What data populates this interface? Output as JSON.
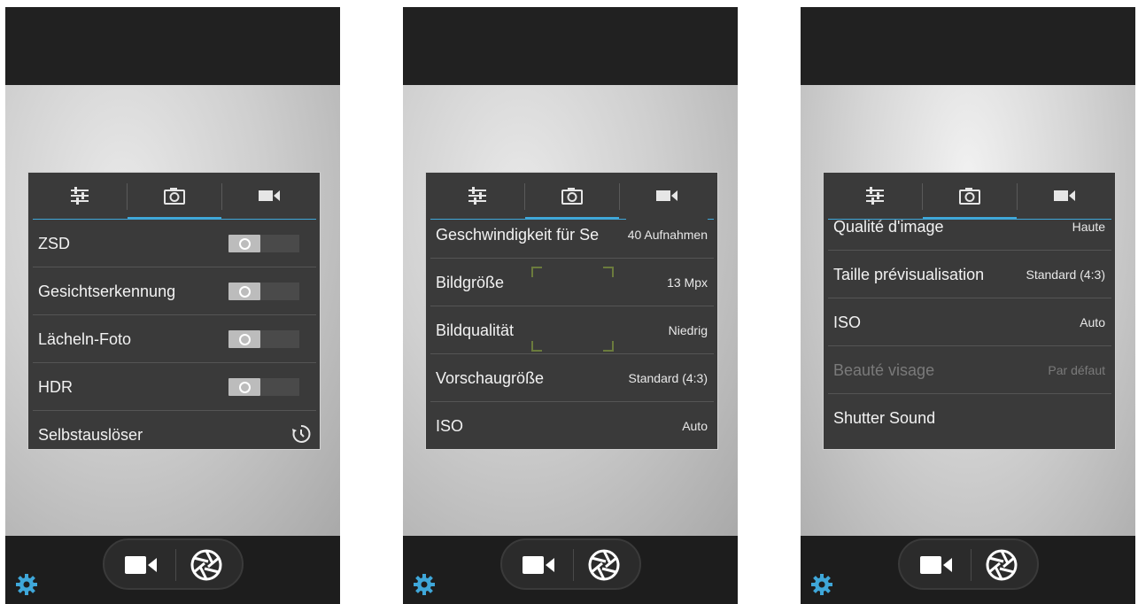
{
  "screens": [
    {
      "rows": [
        {
          "label": "ZSD",
          "control": "toggle"
        },
        {
          "label": "Gesichtserkennung",
          "control": "toggle"
        },
        {
          "label": "Lächeln-Foto",
          "control": "toggle"
        },
        {
          "label": "HDR",
          "control": "toggle"
        },
        {
          "label": "Selbstauslöser",
          "control": "timer-icon"
        }
      ]
    },
    {
      "rows": [
        {
          "label": "Geschwindigkeit für Se",
          "value": "40 Aufnahmen"
        },
        {
          "label": "Bildgröße",
          "value": "13 Mpx"
        },
        {
          "label": "Bildqualität",
          "value": "Niedrig"
        },
        {
          "label": "Vorschaugröße",
          "value": "Standard (4:3)"
        },
        {
          "label": "ISO",
          "value": "Auto"
        }
      ]
    },
    {
      "rows": [
        {
          "label": "Qualité d'image",
          "value": "Haute"
        },
        {
          "label": "Taille prévisualisation",
          "value": "Standard (4:3)"
        },
        {
          "label": "ISO",
          "value": "Auto"
        },
        {
          "label": "Beauté visage",
          "value": "Par défaut",
          "disabled": true
        },
        {
          "label": "Shutter Sound",
          "value": ""
        }
      ]
    }
  ],
  "tabs": [
    "sliders-icon",
    "camera-icon",
    "video-camera-icon"
  ],
  "active_tab": 1,
  "colors": {
    "accent": "#3fa7d9",
    "panel": "#3a3a3a",
    "bar": "#212121"
  }
}
